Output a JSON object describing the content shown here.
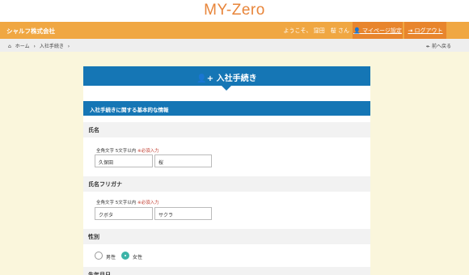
{
  "header": {
    "logo_text": "MY-Zero",
    "company": "シャルフ株式会社",
    "welcome": "ようこそ、 窪田　桜 さん",
    "mypage_label": "マイページ設定",
    "logout_label": "ログアウト"
  },
  "breadcrumb": {
    "home": "ホーム",
    "separator": "›",
    "current": "入社手続き",
    "back": "前へ戻る"
  },
  "card": {
    "title": "入社手続き",
    "section_title": "入社手続きに関する基本的な情報"
  },
  "fields": {
    "name": {
      "label": "氏名",
      "hint": "全角文字 5文字以内",
      "required": "※必須入力",
      "last": "久保田",
      "first": "桜"
    },
    "kana": {
      "label": "氏名フリガナ",
      "hint": "全角文字 5文字以内",
      "required": "※必須入力",
      "last": "クボタ",
      "first": "サクラ"
    },
    "gender": {
      "label": "性別",
      "options": [
        "男性",
        "女性"
      ],
      "selected": "女性"
    },
    "birthdate": {
      "label": "生年月日"
    }
  },
  "colors": {
    "orange_bar": "#f0a742",
    "button_orange": "#e8852d",
    "blue_header": "#1576b5",
    "selected_radio": "#3cb4a8"
  }
}
